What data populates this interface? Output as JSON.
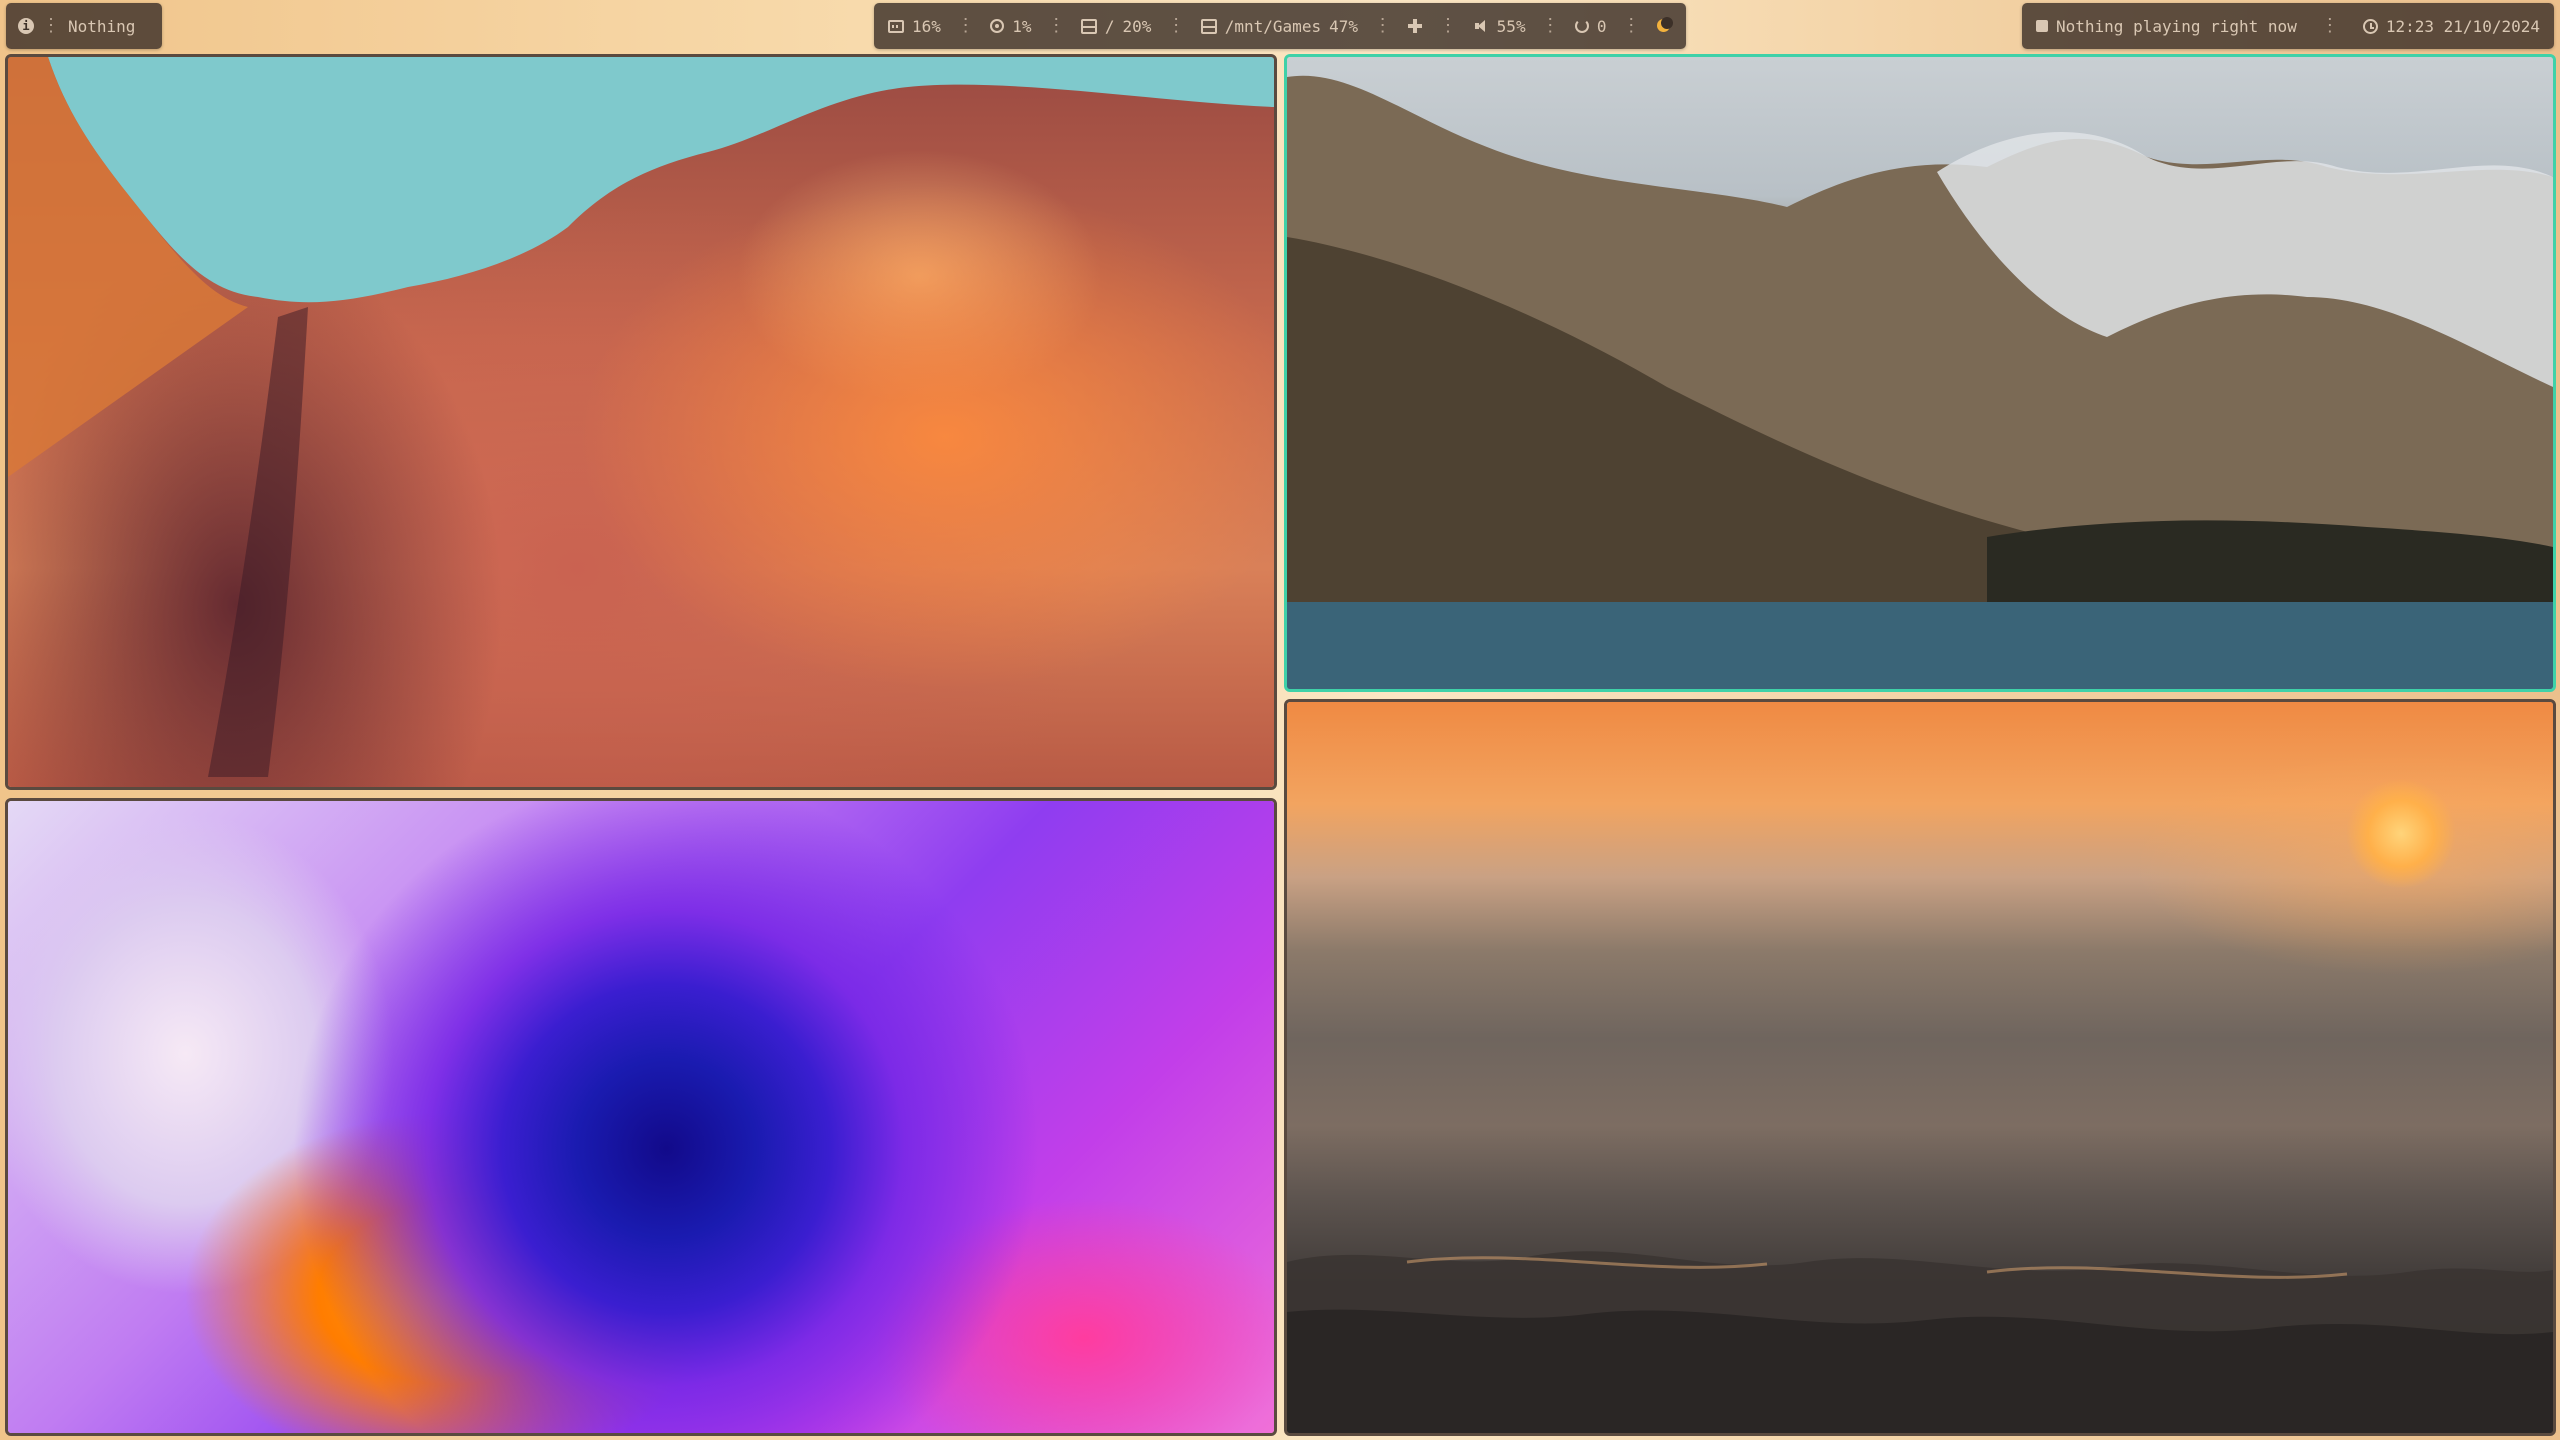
{
  "topbar": {
    "left": {
      "info_icon_glyph": "i",
      "window_title": "Nothing"
    },
    "center": {
      "ram": "16%",
      "cpu": "1%",
      "disk_root_label": "/",
      "disk_root": "20%",
      "disk_games_label": "/mnt/Games",
      "disk_games": "47%",
      "volume": "55%",
      "updates": "0"
    },
    "right": {
      "media": "Nothing playing right now",
      "clock": "12:23 21/10/2024"
    },
    "separator": "⋮"
  },
  "windows": [
    {
      "name": "canyon",
      "active": false
    },
    {
      "name": "mountains",
      "active": true
    },
    {
      "name": "spiral",
      "active": false
    },
    {
      "name": "sunset",
      "active": false
    }
  ],
  "colors": {
    "bar_pill": "#3c3028",
    "bar_text": "#d9c7b3",
    "active_border": "#3fd1a8",
    "inactive_border": "#5a4a3f",
    "night_light": "#f3b23d"
  },
  "icons": [
    "info-icon",
    "ram-icon",
    "cpu-icon",
    "disk-icon",
    "network-icon",
    "volume-icon",
    "updates-icon",
    "night-light-icon",
    "media-stop-icon",
    "clock-icon"
  ]
}
